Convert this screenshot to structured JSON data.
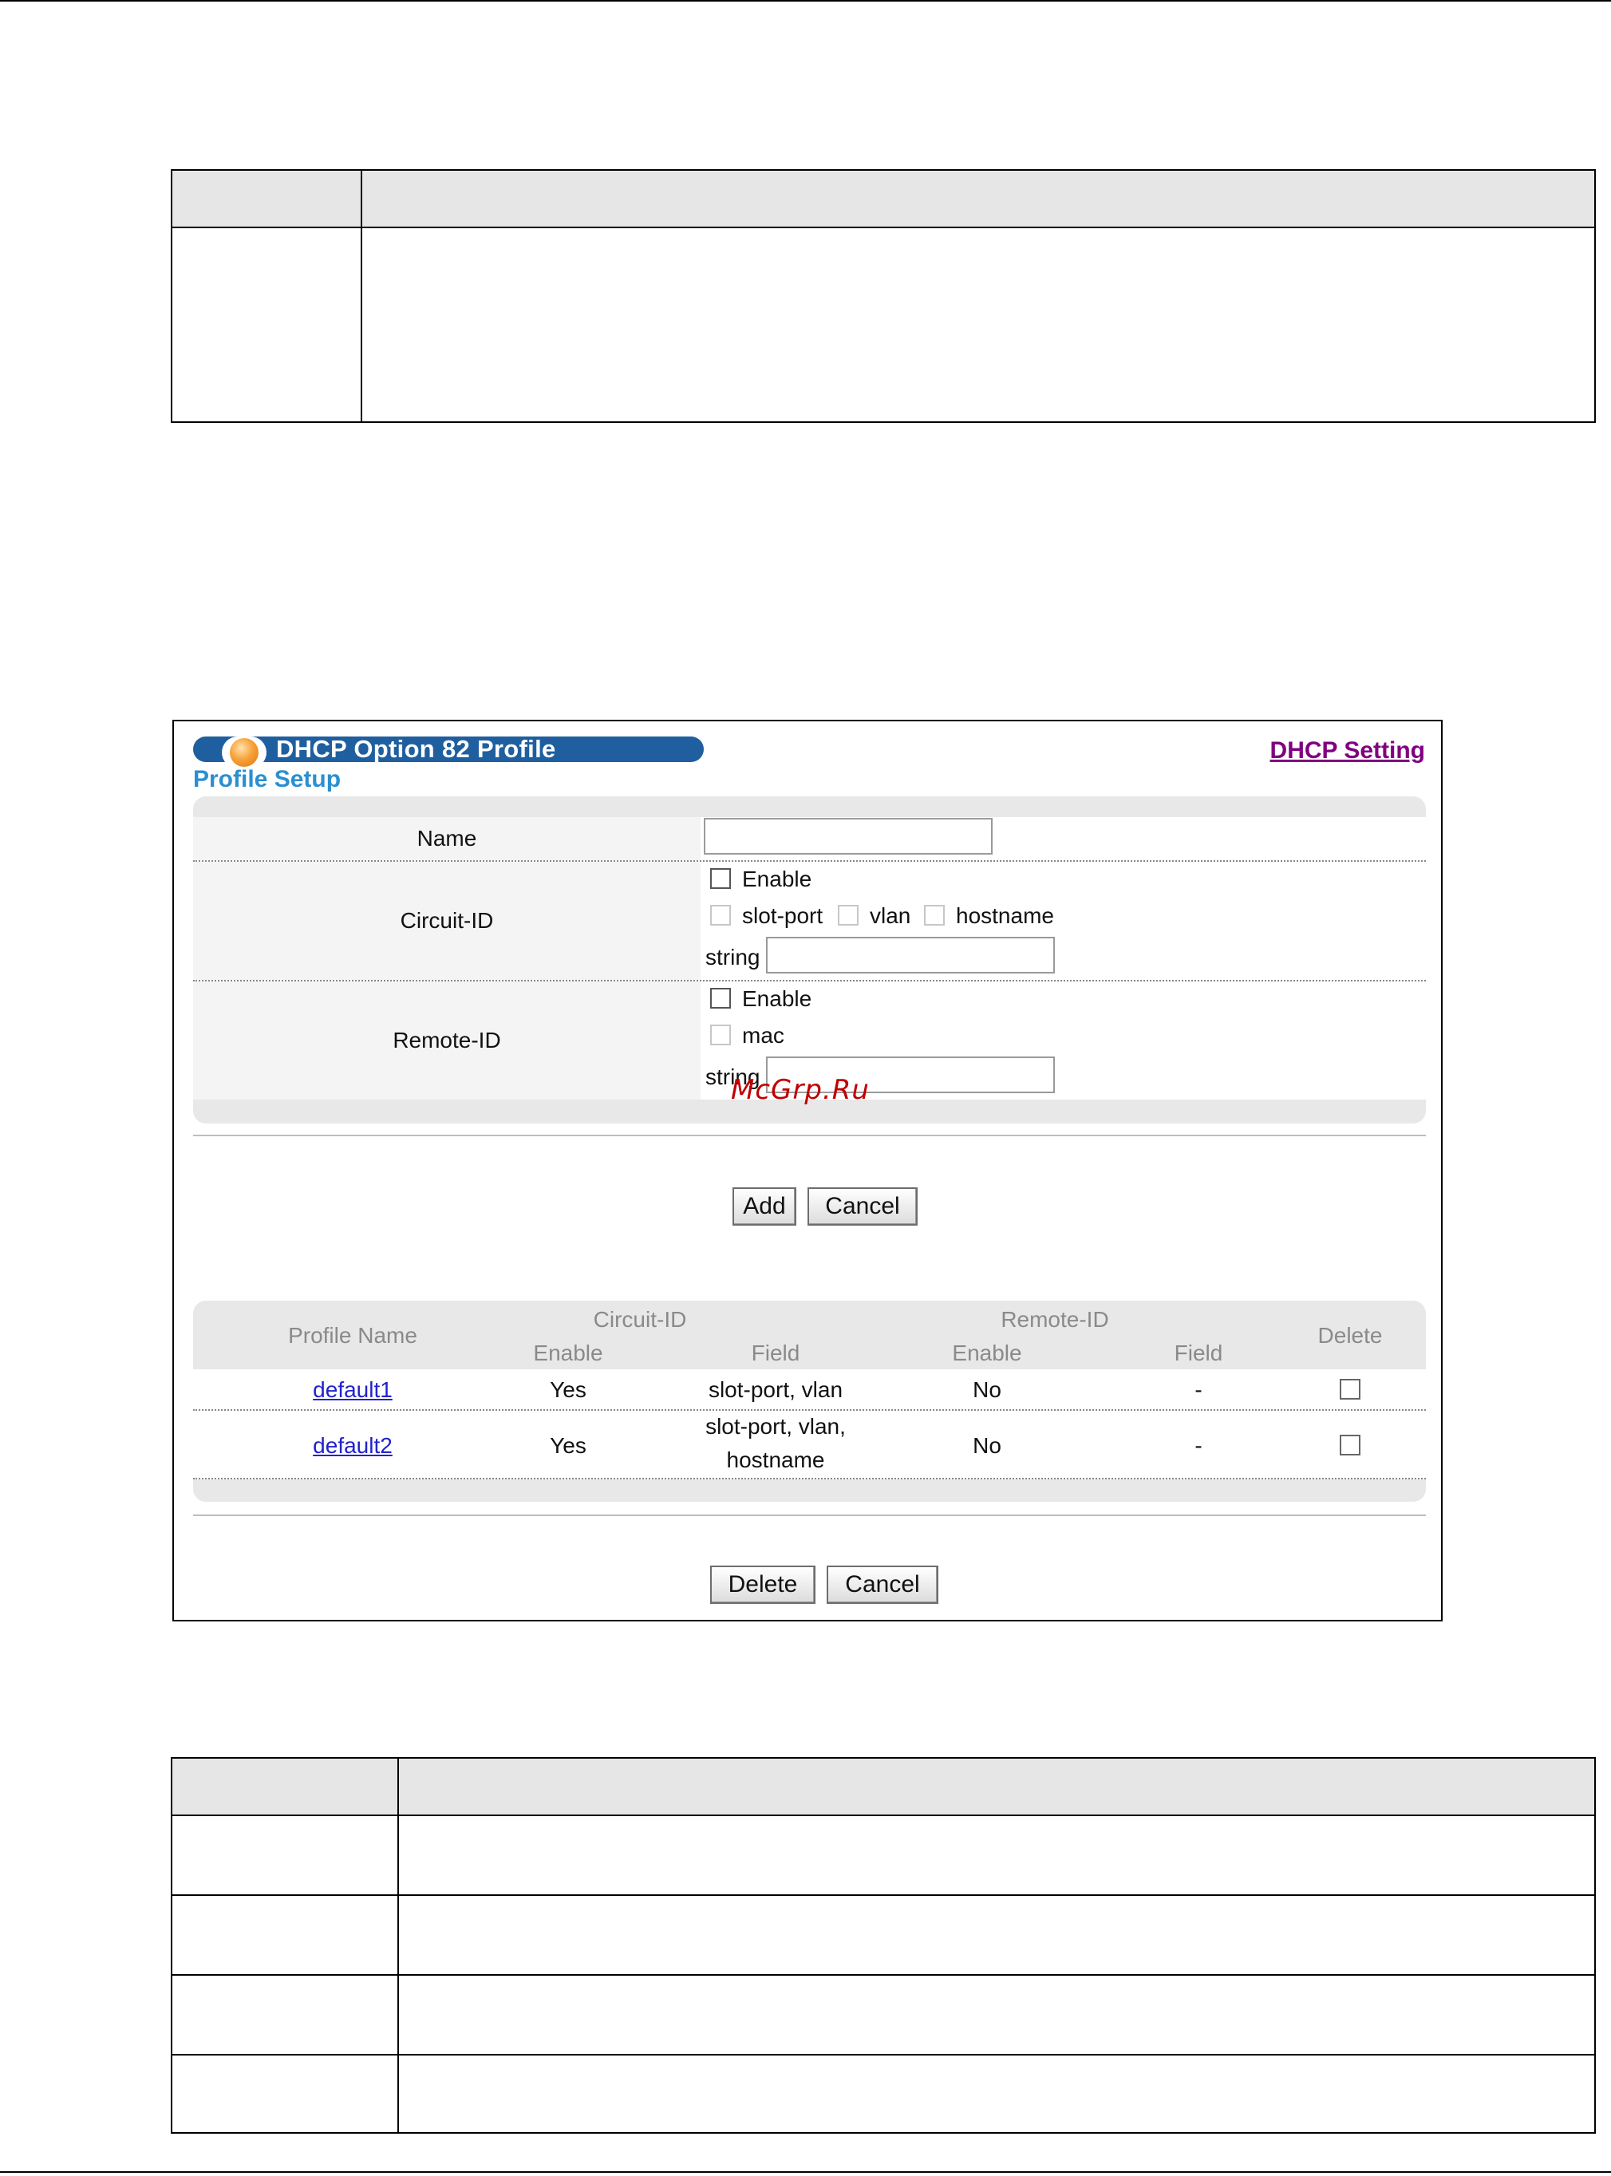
{
  "screen": {
    "title": "DHCP Option 82 Profile",
    "dhcp_setting_link": "DHCP Setting",
    "section_title": "Profile Setup",
    "form": {
      "name_label": "Name",
      "name_value": "",
      "circuit_label": "Circuit-ID",
      "circuit_enable": "Enable",
      "circuit_opt_slot_port": "slot-port",
      "circuit_opt_vlan": "vlan",
      "circuit_opt_hostname": "hostname",
      "circuit_string_label": "string",
      "circuit_string_value": "",
      "remote_label": "Remote-ID",
      "remote_enable": "Enable",
      "remote_opt_mac": "mac",
      "remote_string_label": "string",
      "remote_string_value": ""
    },
    "buttons": {
      "add": "Add",
      "cancel": "Cancel",
      "delete": "Delete",
      "cancel2": "Cancel"
    },
    "table": {
      "headers": {
        "profile_name": "Profile Name",
        "circuit_id": "Circuit-ID",
        "remote_id": "Remote-ID",
        "delete": "Delete",
        "c_enable": "Enable",
        "c_field": "Field",
        "r_enable": "Enable",
        "r_field": "Field"
      },
      "rows": [
        {
          "name": "default1",
          "c_enable": "Yes",
          "c_field": "slot-port, vlan",
          "c_field_line2": "",
          "r_enable": "No",
          "r_field": "-"
        },
        {
          "name": "default2",
          "c_enable": "Yes",
          "c_field": "slot-port, vlan,",
          "c_field_line2": "hostname",
          "r_enable": "No",
          "r_field": "-"
        }
      ]
    },
    "watermark": "McGrp.Ru"
  }
}
